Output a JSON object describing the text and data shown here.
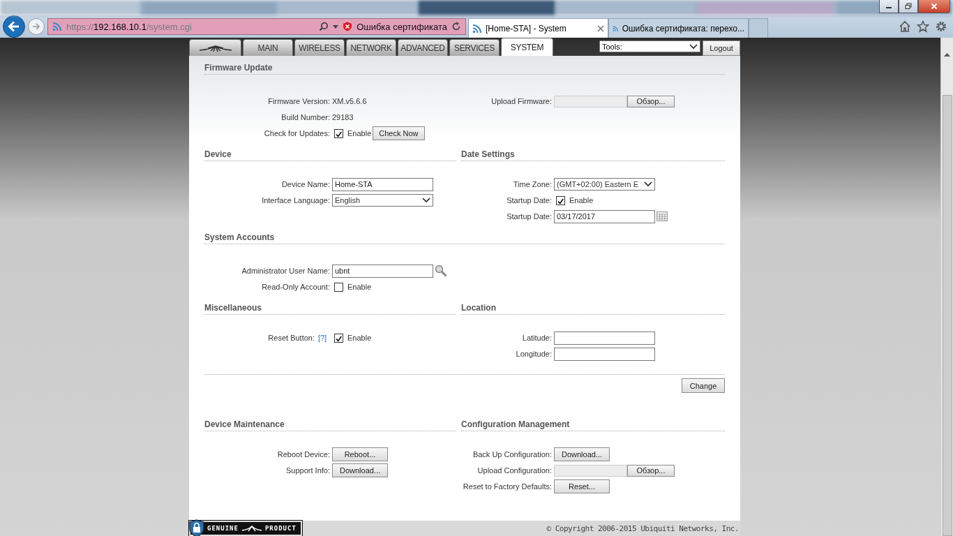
{
  "browser": {
    "url": {
      "scheme": "https://",
      "host": "192.168.10.1",
      "path": "/system.cgi"
    },
    "cert_error": "Ошибка сертификата",
    "tabs": [
      {
        "label": "[Home-STA] - System",
        "selected": true
      },
      {
        "label": "Ошибка сертификата: перехо...",
        "selected": false
      }
    ]
  },
  "nav": {
    "tabs": [
      {
        "kind": "logo",
        "selected": false
      },
      {
        "kind": "text",
        "label": "MAIN",
        "selected": false
      },
      {
        "kind": "text",
        "label": "WIRELESS",
        "selected": false
      },
      {
        "kind": "text",
        "label": "NETWORK",
        "selected": false
      },
      {
        "kind": "text",
        "label": "ADVANCED",
        "selected": false
      },
      {
        "kind": "text",
        "label": "SERVICES",
        "selected": false
      },
      {
        "kind": "text",
        "label": "SYSTEM",
        "selected": true
      }
    ],
    "tools": "Tools:",
    "logout": "Logout"
  },
  "blocks": [
    {
      "kind": "full",
      "title": "Firmware Update",
      "left": {
        "fields": [
          {
            "kind": "text",
            "label": "Firmware Version:",
            "value": "XM.v5.6.6"
          },
          {
            "kind": "text",
            "label": "Build Number:",
            "value": "29183"
          },
          {
            "kind": "checkbox",
            "label": "Check for Updates:",
            "checked": true,
            "text": "Enable",
            "button": "Check Now"
          }
        ]
      },
      "right": {
        "fields": [
          {
            "kind": "file",
            "label": "Upload Firmware:",
            "button": "Обзор..."
          }
        ]
      }
    },
    {
      "kind": "pair",
      "left": {
        "title": "Device",
        "fields": [
          {
            "kind": "input",
            "label": "Device Name:",
            "value": "Home-STA"
          },
          {
            "kind": "select",
            "label": "Interface Language:",
            "value": "English"
          }
        ]
      },
      "right": {
        "title": "Date Settings",
        "fields": [
          {
            "kind": "select",
            "label": "Time Zone:",
            "value": "(GMT+02:00) Eastern E"
          },
          {
            "kind": "checkbox",
            "label": "Startup Date:",
            "checked": true,
            "text": "Enable"
          },
          {
            "kind": "date",
            "label": "Startup Date:",
            "value": "03/17/2017"
          }
        ]
      }
    },
    {
      "kind": "full",
      "title": "System Accounts",
      "left": {
        "fields": [
          {
            "kind": "lookup",
            "label": "Administrator User Name:",
            "value": "ubnt"
          },
          {
            "kind": "checkbox",
            "label": "Read-Only Account:",
            "checked": false,
            "text": "Enable"
          }
        ]
      }
    },
    {
      "kind": "pair",
      "left": {
        "title": "Miscellaneous",
        "fields": [
          {
            "kind": "checkbox",
            "label": "Reset Button:",
            "help": "[?]",
            "checked": true,
            "text": "Enable"
          }
        ]
      },
      "right": {
        "title": "Location",
        "fields": [
          {
            "kind": "input",
            "label": "Latitude:"
          },
          {
            "kind": "input",
            "label": "Longitude:"
          }
        ]
      }
    },
    {
      "kind": "action",
      "button": "Change"
    },
    {
      "kind": "pair",
      "left": {
        "title": "Device Maintenance",
        "fields": [
          {
            "kind": "button",
            "label": "Reboot Device:",
            "button": "Reboot..."
          },
          {
            "kind": "button",
            "label": "Support Info:",
            "button": "Download..."
          }
        ]
      },
      "right": {
        "title": "Configuration Management",
        "fields": [
          {
            "kind": "button",
            "label": "Back Up Configuration:",
            "button": "Download..."
          },
          {
            "kind": "file",
            "label": "Upload Configuration:",
            "button": "Обзор..."
          },
          {
            "kind": "button",
            "label": "Reset to Factory Defaults:",
            "button": "Reset..."
          }
        ]
      }
    }
  ],
  "footer": {
    "badge": [
      "GENUINE",
      "PRODUCT"
    ],
    "copyright": "© Copyright 2006-2015 Ubiquiti Networks, Inc."
  }
}
